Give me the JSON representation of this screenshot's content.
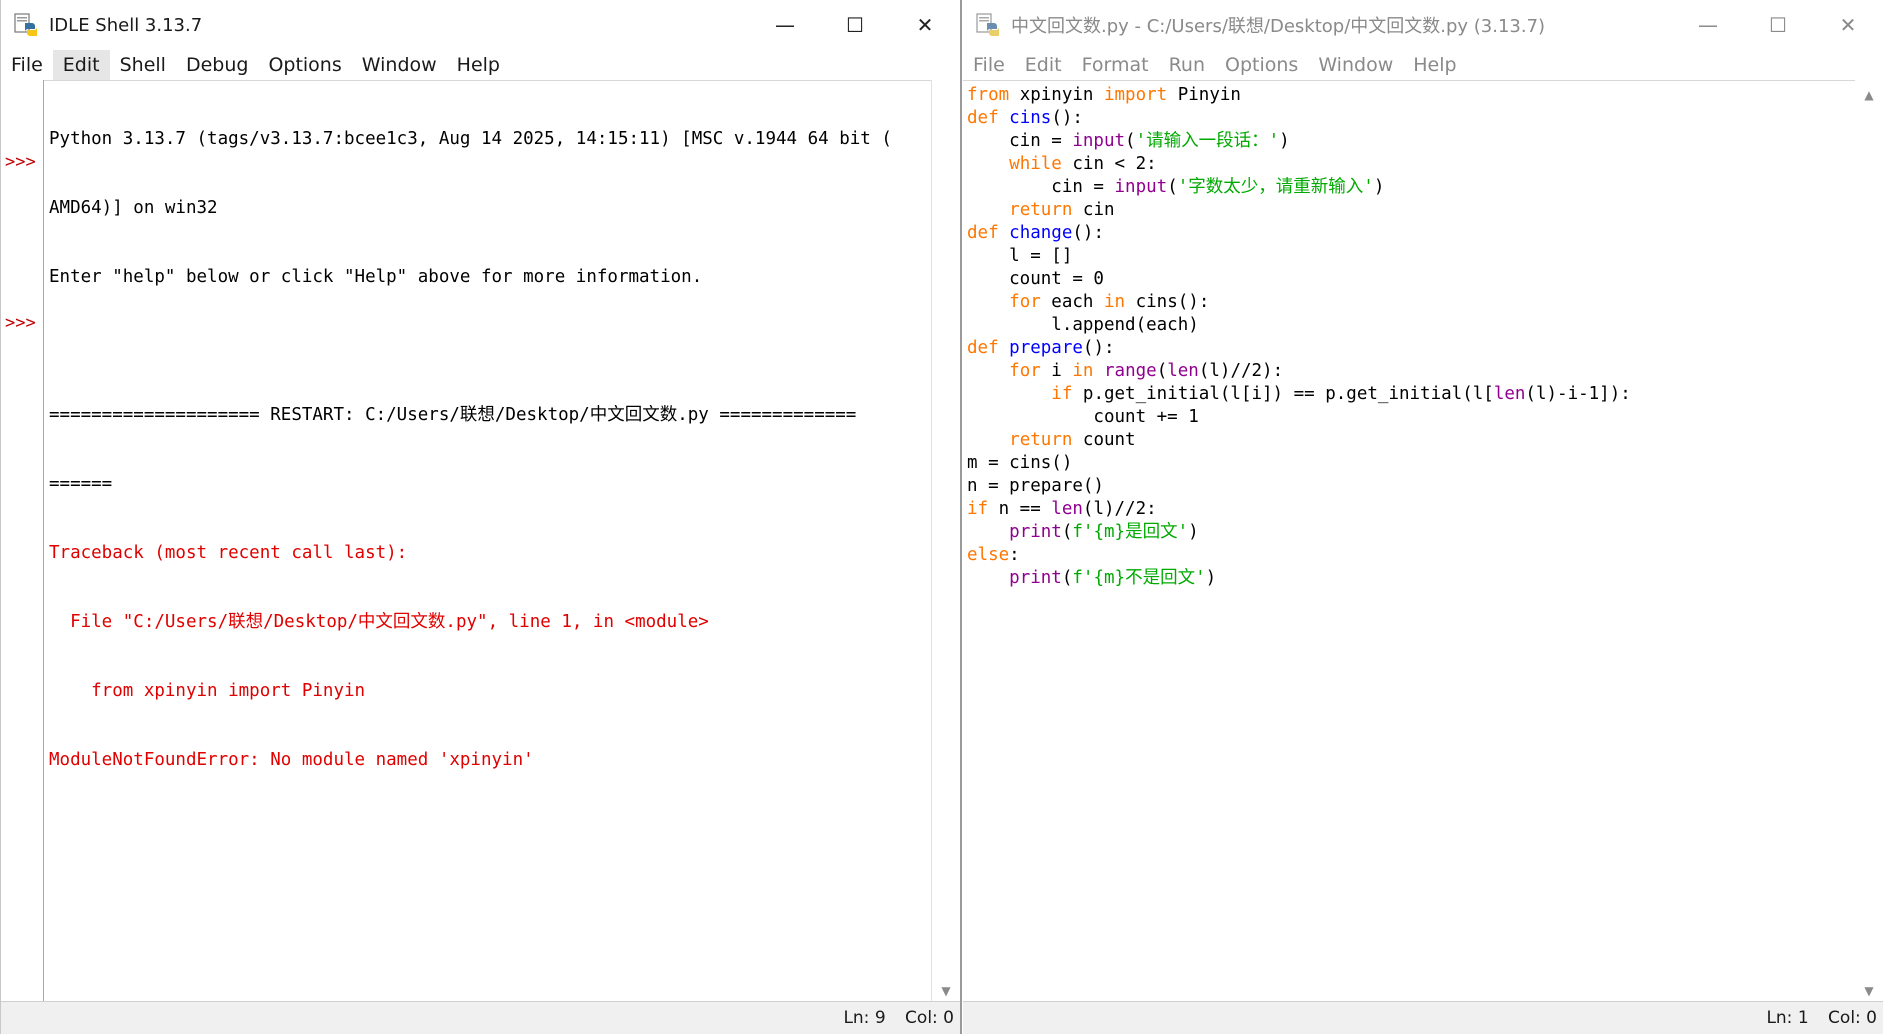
{
  "shell": {
    "title": "IDLE Shell 3.13.7",
    "caption": {
      "minimize": "—",
      "maximize": "☐",
      "close": "✕"
    },
    "menu": [
      "File",
      "Edit",
      "Shell",
      "Debug",
      "Options",
      "Window",
      "Help"
    ],
    "prompt": ">>>",
    "lines": [
      "Python 3.13.7 (tags/v3.13.7:bcee1c3, Aug 14 2025, 14:15:11) [MSC v.1944 64 bit (",
      "AMD64)] on win32",
      "Enter \"help\" below or click \"Help\" above for more information.",
      "",
      "==================== RESTART: C:/Users/联想/Desktop/中文回文数.py =============",
      "======",
      "Traceback (most recent call last):",
      "  File \"C:/Users/联想/Desktop/中文回文数.py\", line 1, in <module>",
      "    from xpinyin import Pinyin",
      "ModuleNotFoundError: No module named 'xpinyin'",
      ""
    ],
    "status": {
      "ln": "Ln: 9",
      "col": "Col: 0"
    }
  },
  "editor": {
    "title": "中文回文数.py - C:/Users/联想/Desktop/中文回文数.py (3.13.7)",
    "caption": {
      "minimize": "—",
      "maximize": "☐",
      "close": "✕"
    },
    "menu": [
      "File",
      "Edit",
      "Format",
      "Run",
      "Options",
      "Window",
      "Help"
    ],
    "status": {
      "ln": "Ln: 1",
      "col": "Col: 0"
    }
  },
  "code": [
    [
      [
        "kw",
        "from"
      ],
      [
        "plain",
        " xpinyin "
      ],
      [
        "kw",
        "import"
      ],
      [
        "plain",
        " Pinyin"
      ]
    ],
    [
      [
        "kw",
        "def"
      ],
      [
        "plain",
        " "
      ],
      [
        "def",
        "cins"
      ],
      [
        "plain",
        "():"
      ]
    ],
    [
      [
        "plain",
        "    cin = "
      ],
      [
        "bi",
        "input"
      ],
      [
        "plain",
        "("
      ],
      [
        "str",
        "'请输入一段话：'"
      ],
      [
        "plain",
        ")"
      ]
    ],
    [
      [
        "plain",
        "    "
      ],
      [
        "kw",
        "while"
      ],
      [
        "plain",
        " cin < 2:"
      ]
    ],
    [
      [
        "plain",
        "        cin = "
      ],
      [
        "bi",
        "input"
      ],
      [
        "plain",
        "("
      ],
      [
        "str",
        "'字数太少，请重新输入'"
      ],
      [
        "plain",
        ")"
      ]
    ],
    [
      [
        "plain",
        "    "
      ],
      [
        "kw",
        "return"
      ],
      [
        "plain",
        " cin"
      ]
    ],
    [
      [
        "kw",
        "def"
      ],
      [
        "plain",
        " "
      ],
      [
        "def",
        "change"
      ],
      [
        "plain",
        "():"
      ]
    ],
    [
      [
        "plain",
        "    l = []"
      ]
    ],
    [
      [
        "plain",
        "    count = 0"
      ]
    ],
    [
      [
        "plain",
        "    "
      ],
      [
        "kw",
        "for"
      ],
      [
        "plain",
        " each "
      ],
      [
        "kw",
        "in"
      ],
      [
        "plain",
        " cins():"
      ]
    ],
    [
      [
        "plain",
        "        l.append(each)"
      ]
    ],
    [
      [
        "kw",
        "def"
      ],
      [
        "plain",
        " "
      ],
      [
        "def",
        "prepare"
      ],
      [
        "plain",
        "():"
      ]
    ],
    [
      [
        "plain",
        "    "
      ],
      [
        "kw",
        "for"
      ],
      [
        "plain",
        " i "
      ],
      [
        "kw",
        "in"
      ],
      [
        "plain",
        " "
      ],
      [
        "bi",
        "range"
      ],
      [
        "plain",
        "("
      ],
      [
        "bi",
        "len"
      ],
      [
        "plain",
        "(l)//2):"
      ]
    ],
    [
      [
        "plain",
        "        "
      ],
      [
        "kw",
        "if"
      ],
      [
        "plain",
        " p.get_initial(l[i]) == p.get_initial(l["
      ],
      [
        "bi",
        "len"
      ],
      [
        "plain",
        "(l)-i-1]):"
      ]
    ],
    [
      [
        "plain",
        "            count += 1"
      ]
    ],
    [
      [
        "plain",
        "    "
      ],
      [
        "kw",
        "return"
      ],
      [
        "plain",
        " count"
      ]
    ],
    [
      [
        "plain",
        "m = cins()"
      ]
    ],
    [
      [
        "plain",
        "n = prepare()"
      ]
    ],
    [
      [
        "kw",
        "if"
      ],
      [
        "plain",
        " n == "
      ],
      [
        "bi",
        "len"
      ],
      [
        "plain",
        "(l)//2:"
      ]
    ],
    [
      [
        "plain",
        "    "
      ],
      [
        "bi",
        "print"
      ],
      [
        "plain",
        "("
      ],
      [
        "str",
        "f'{m}是回文'"
      ],
      [
        "plain",
        ")"
      ]
    ],
    [
      [
        "kw",
        "else"
      ],
      [
        "plain",
        ":"
      ]
    ],
    [
      [
        "plain",
        "    "
      ],
      [
        "bi",
        "print"
      ],
      [
        "plain",
        "("
      ],
      [
        "str",
        "f'{m}不是回文'"
      ],
      [
        "plain",
        ")"
      ]
    ]
  ]
}
